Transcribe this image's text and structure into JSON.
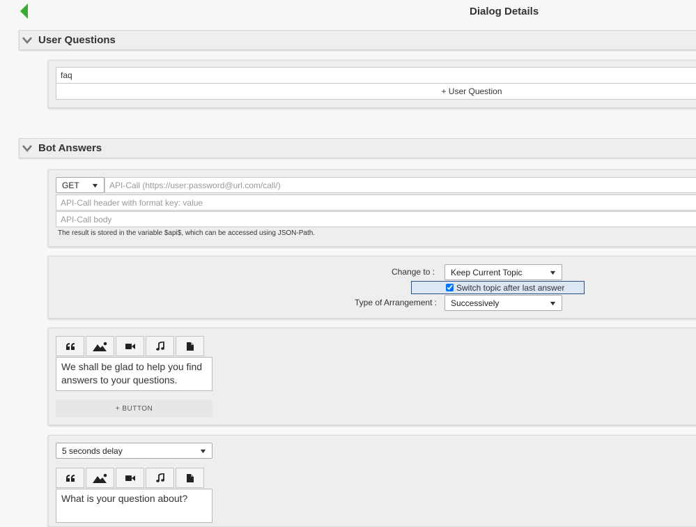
{
  "header": {
    "title": "Dialog Details"
  },
  "user_questions": {
    "title": "User Questions",
    "questions": [
      "faq"
    ],
    "add_label": "+ User Question"
  },
  "bot_answers": {
    "title": "Bot Answers",
    "api": {
      "method": "GET",
      "url_placeholder": "API-Call (https://user:password@url.com/call/)",
      "header_placeholder": "API-Call header with format key: value",
      "body_placeholder": "API-Call body",
      "note": "The result is stored in the variable $api$, which can be accessed using JSON-Path."
    },
    "settings": {
      "change_to_label": "Change to :",
      "change_to_value": "Keep Current Topic",
      "switch_topic_label": "Switch topic after last answer",
      "switch_topic_checked": true,
      "arrangement_label": "Type of Arrangement :",
      "arrangement_value": "Successively"
    },
    "answer1": {
      "text_line1": "We shall be glad to help you find",
      "text_line2": "answers to your questions.",
      "add_button_label": "+ BUTTON"
    },
    "answer2": {
      "delay_value": "5 seconds delay",
      "text_line1": "What is your question about?"
    }
  },
  "icons": {
    "quote": "quote-icon",
    "image": "image-icon",
    "video": "video-icon",
    "audio": "music-icon",
    "file": "file-icon"
  },
  "colors": {
    "accent_green": "#3aa935",
    "highlight_border": "#2a4f8f",
    "highlight_bg": "#dde6f3"
  }
}
